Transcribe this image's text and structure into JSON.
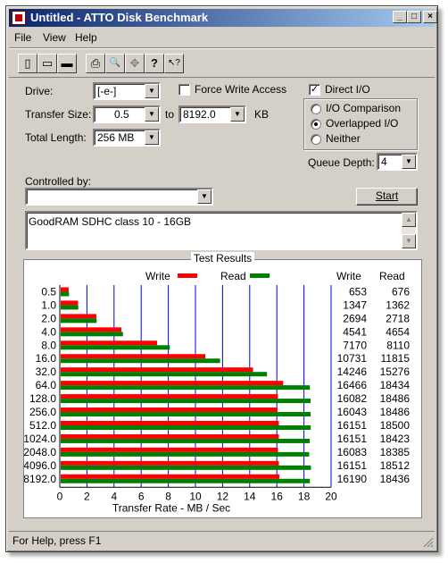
{
  "window": {
    "title": "Untitled - ATTO Disk Benchmark"
  },
  "title_buttons": {
    "minimize": "_",
    "maximize": "□",
    "close": "×"
  },
  "menu": [
    "File",
    "View",
    "Help"
  ],
  "toolbar_icons": [
    "new-icon",
    "open-icon",
    "save-icon",
    "print-icon",
    "print-preview-icon",
    "move-icon",
    "help-icon",
    "context-help-icon"
  ],
  "toolbar_glyphs": [
    "▯",
    "▭",
    "▬",
    "⎙",
    "🔍",
    "✥",
    "?",
    "↖?"
  ],
  "form": {
    "drive_label": "Drive:",
    "drive_value": "[-e-]",
    "force_write_label": "Force Write Access",
    "force_write_checked": false,
    "direct_io_label": "Direct I/O",
    "direct_io_checked": true,
    "transfer_size_label": "Transfer Size:",
    "transfer_from": "0.5",
    "to_label": "to",
    "transfer_to": "8192.0",
    "kb_label": "KB",
    "total_length_label": "Total Length:",
    "total_length_value": "256 MB",
    "io_options": [
      "I/O Comparison",
      "Overlapped I/O",
      "Neither"
    ],
    "io_selected": 1,
    "queue_depth_label": "Queue Depth:",
    "queue_depth_value": "4",
    "controlled_by_label": "Controlled by:",
    "controlled_by_value": "",
    "start_label": "Start",
    "description": "GoodRAM SDHC class 10 - 16GB"
  },
  "results": {
    "title": "Test Results",
    "legend_write": "Write",
    "legend_read": "Read",
    "col_write": "Write",
    "col_read": "Read",
    "write_color": "#ff0000",
    "read_color": "#008000",
    "grid_color": "#0000ff"
  },
  "chart_data": {
    "type": "bar",
    "orientation": "horizontal",
    "categories": [
      "0.5",
      "1.0",
      "2.0",
      "4.0",
      "8.0",
      "16.0",
      "32.0",
      "64.0",
      "128.0",
      "256.0",
      "512.0",
      "1024.0",
      "2048.0",
      "4096.0",
      "8192.0"
    ],
    "series": [
      {
        "name": "Write",
        "values": [
          653,
          1347,
          2694,
          4541,
          7170,
          10731,
          14246,
          16466,
          16082,
          16043,
          16151,
          16151,
          16083,
          16151,
          16190
        ]
      },
      {
        "name": "Read",
        "values": [
          676,
          1362,
          2718,
          4654,
          8110,
          11815,
          15276,
          18434,
          18486,
          18486,
          18500,
          18423,
          18385,
          18512,
          18436
        ]
      }
    ],
    "xlabel": "Transfer Rate - MB / Sec",
    "xlim": [
      0,
      20
    ],
    "xticks": [
      "0",
      "2",
      "4",
      "6",
      "8",
      "10",
      "12",
      "14",
      "16",
      "18",
      "20"
    ],
    "grid": true
  },
  "status": {
    "text": "For Help, press F1"
  }
}
